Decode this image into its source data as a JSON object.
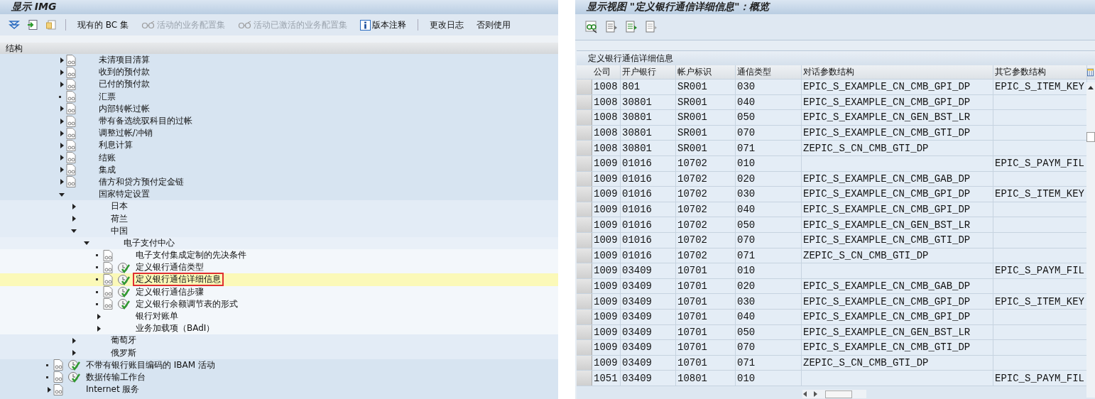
{
  "left_window": {
    "title": "显示 IMG",
    "toolbar": [
      {
        "label": "现有的 BC 集",
        "disabled": false
      },
      {
        "label": "活动的业务配置集",
        "disabled": true
      },
      {
        "label": "活动已激活的业务配置集",
        "disabled": true
      },
      {
        "label": "版本注释",
        "disabled": false
      },
      {
        "label": "更改日志",
        "disabled": false
      },
      {
        "label": "否则使用",
        "disabled": false
      }
    ],
    "tree": {
      "heading": "结构",
      "nested_items": [
        {
          "label": "未清项目清算",
          "kind": "topic",
          "expanded": false,
          "selected": false
        },
        {
          "label": "收到的预付款",
          "kind": "topic",
          "expanded": false,
          "selected": false
        },
        {
          "label": "已付的预付款",
          "kind": "topic",
          "expanded": false,
          "selected": false
        },
        {
          "label": "汇票",
          "kind": "note",
          "selected": false
        },
        {
          "label": "内部转帐过帐",
          "kind": "topic",
          "expanded": false,
          "selected": false
        },
        {
          "label": "带有备选统驭科目的过帐",
          "kind": "topic",
          "expanded": false,
          "selected": false
        },
        {
          "label": "调整过帐/冲销",
          "kind": "topic",
          "expanded": false,
          "selected": false
        },
        {
          "label": "利息计算",
          "kind": "topic",
          "expanded": false,
          "selected": false
        },
        {
          "label": "结账",
          "kind": "topic",
          "expanded": false,
          "selected": false
        },
        {
          "label": "集成",
          "kind": "topic",
          "expanded": false,
          "selected": false
        },
        {
          "label": "借方和贷方预付定金链",
          "kind": "topic",
          "expanded": false,
          "selected": false
        },
        {
          "label": "国家特定设置",
          "kind": "group",
          "expanded": true,
          "selected": false,
          "children": [
            {
              "label": "日本",
              "kind": "group",
              "expanded": false,
              "selected": false
            },
            {
              "label": "荷兰",
              "kind": "group",
              "expanded": false,
              "selected": false
            },
            {
              "label": "中国",
              "kind": "group",
              "expanded": true,
              "selected": false,
              "children": [
                {
                  "label": "电子支付中心",
                  "kind": "group",
                  "expanded": true,
                  "selected": false,
                  "children": [
                    {
                      "label": "电子支付集成定制的先决条件",
                      "kind": "note",
                      "selected": false
                    },
                    {
                      "label": "定义银行通信类型",
                      "kind": "task",
                      "selected": false
                    },
                    {
                      "label": "定义银行通信详细信息",
                      "kind": "task",
                      "selected": true
                    },
                    {
                      "label": "定义银行通信步骤",
                      "kind": "task",
                      "selected": false
                    },
                    {
                      "label": "定义银行余额调节表的形式",
                      "kind": "task",
                      "selected": false
                    },
                    {
                      "label": "银行对账单",
                      "kind": "group",
                      "expanded": false,
                      "selected": false
                    },
                    {
                      "label": "业务加载项（BAdI）",
                      "kind": "group",
                      "expanded": false,
                      "selected": false
                    }
                  ]
                }
              ]
            },
            {
              "label": "葡萄牙",
              "kind": "group",
              "expanded": false,
              "selected": false
            },
            {
              "label": "俄罗斯",
              "kind": "group",
              "expanded": false,
              "selected": false
            }
          ]
        }
      ],
      "items": [
        {
          "label": "不带有银行账目编码的 IBAM 活动",
          "kind": "task",
          "selected": false
        },
        {
          "label": "数据传输工作台",
          "kind": "task",
          "selected": false
        },
        {
          "label": "Internet 服务",
          "kind": "topic",
          "expanded": false,
          "selected": false
        }
      ]
    }
  },
  "right_window": {
    "title": "显示视图 \"定义银行通信详细信息\"：概览",
    "table": {
      "title": "定义银行通信详细信息",
      "columns": [
        "公司",
        "开户银行",
        "帐户标识",
        "通信类型",
        "对话参数结构",
        "其它参数结构"
      ],
      "rows": [
        [
          "1008",
          "801",
          "SR001",
          "030",
          "EPIC_S_EXAMPLE_CN_CMB_GPI_DP",
          "EPIC_S_ITEM_KEY"
        ],
        [
          "1008",
          "30801",
          "SR001",
          "040",
          "EPIC_S_EXAMPLE_CN_CMB_GPI_DP",
          ""
        ],
        [
          "1008",
          "30801",
          "SR001",
          "050",
          "EPIC_S_EXAMPLE_CN_GEN_BST_LR",
          ""
        ],
        [
          "1008",
          "30801",
          "SR001",
          "070",
          "EPIC_S_EXAMPLE_CN_CMB_GTI_DP",
          ""
        ],
        [
          "1008",
          "30801",
          "SR001",
          "071",
          "ZEPIC_S_CN_CMB_GTI_DP",
          ""
        ],
        [
          "1009",
          "01016",
          "10702",
          "010",
          "",
          "EPIC_S_PAYM_FIL"
        ],
        [
          "1009",
          "01016",
          "10702",
          "020",
          "EPIC_S_EXAMPLE_CN_CMB_GAB_DP",
          ""
        ],
        [
          "1009",
          "01016",
          "10702",
          "030",
          "EPIC_S_EXAMPLE_CN_CMB_GPI_DP",
          "EPIC_S_ITEM_KEY"
        ],
        [
          "1009",
          "01016",
          "10702",
          "040",
          "EPIC_S_EXAMPLE_CN_CMB_GPI_DP",
          ""
        ],
        [
          "1009",
          "01016",
          "10702",
          "050",
          "EPIC_S_EXAMPLE_CN_GEN_BST_LR",
          ""
        ],
        [
          "1009",
          "01016",
          "10702",
          "070",
          "EPIC_S_EXAMPLE_CN_CMB_GTI_DP",
          ""
        ],
        [
          "1009",
          "01016",
          "10702",
          "071",
          "ZEPIC_S_CN_CMB_GTI_DP",
          ""
        ],
        [
          "1009",
          "03409",
          "10701",
          "010",
          "",
          "EPIC_S_PAYM_FIL"
        ],
        [
          "1009",
          "03409",
          "10701",
          "020",
          "EPIC_S_EXAMPLE_CN_CMB_GAB_DP",
          ""
        ],
        [
          "1009",
          "03409",
          "10701",
          "030",
          "EPIC_S_EXAMPLE_CN_CMB_GPI_DP",
          "EPIC_S_ITEM_KEY"
        ],
        [
          "1009",
          "03409",
          "10701",
          "040",
          "EPIC_S_EXAMPLE_CN_CMB_GPI_DP",
          ""
        ],
        [
          "1009",
          "03409",
          "10701",
          "050",
          "EPIC_S_EXAMPLE_CN_GEN_BST_LR",
          ""
        ],
        [
          "1009",
          "03409",
          "10701",
          "070",
          "EPIC_S_EXAMPLE_CN_CMB_GTI_DP",
          ""
        ],
        [
          "1009",
          "03409",
          "10701",
          "071",
          "ZEPIC_S_CN_CMB_GTI_DP",
          ""
        ],
        [
          "1051",
          "03409",
          "10801",
          "010",
          "",
          "EPIC_S_PAYM_FIL"
        ]
      ]
    }
  }
}
